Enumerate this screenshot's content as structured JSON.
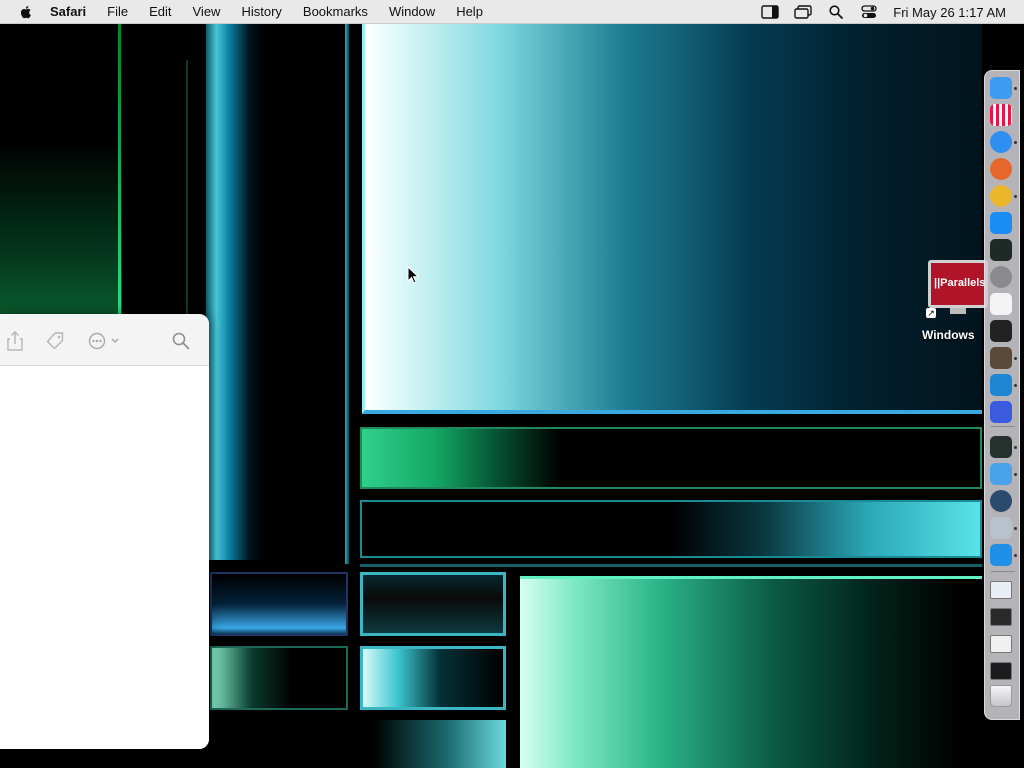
{
  "menubar": {
    "apple_icon": "apple-logo-icon",
    "app_name": "Safari",
    "menus": [
      "File",
      "Edit",
      "View",
      "History",
      "Bookmarks",
      "Window",
      "Help"
    ],
    "status_icons": [
      "sidebar-icon",
      "screen-mirroring-icon",
      "spotlight-search-icon",
      "control-center-icon"
    ],
    "clock": "Fri May 26  1:17 AM"
  },
  "safari": {
    "toolbar_icons": [
      "share-icon",
      "tag-icon",
      "more-options-icon",
      "search-icon"
    ]
  },
  "desktop": {
    "icon_label": "Windows",
    "icon_screen_text": "||Parallels",
    "icon_name": "parallels-windows-vm-icon"
  },
  "dock": {
    "apps": [
      {
        "name": "Finder",
        "icon": "finder-icon",
        "color": "#3d9bf0",
        "running": true
      },
      {
        "name": "Launchpad",
        "icon": "launchpad-icon",
        "color": "#f2f2f2",
        "running": false
      },
      {
        "name": "Safari",
        "icon": "safari-icon",
        "color": "#2f8ff0",
        "running": true
      },
      {
        "name": "Firefox",
        "icon": "firefox-icon",
        "color": "#e8672c",
        "running": false
      },
      {
        "name": "Chrome",
        "icon": "chrome-icon",
        "color": "#e9b62c",
        "running": true
      },
      {
        "name": "App Store",
        "icon": "app-store-icon",
        "color": "#1c8cf5",
        "running": false
      },
      {
        "name": "Activity Monitor",
        "icon": "activity-monitor-icon",
        "color": "#1f2a27",
        "running": false
      },
      {
        "name": "System Settings",
        "icon": "system-settings-icon",
        "color": "#8a8a8e",
        "running": false
      },
      {
        "name": "TextEdit",
        "icon": "textedit-icon",
        "color": "#f4f4f4",
        "running": false
      },
      {
        "name": "Terminal",
        "icon": "terminal-icon",
        "color": "#222222",
        "running": false
      },
      {
        "name": "Xcode Instruments",
        "icon": "instruments-icon",
        "color": "#5a4a3a",
        "running": true
      },
      {
        "name": "Visual Studio Code",
        "icon": "vscode-icon",
        "color": "#1f86d6",
        "running": true
      },
      {
        "name": "Simulator",
        "icon": "simulator-icon",
        "color": "#3a5be0",
        "running": false
      },
      {
        "name": "Activity Monitor 2",
        "icon": "monitor-graph-icon",
        "color": "#26302d",
        "running": true
      },
      {
        "name": "Parallels Desktop",
        "icon": "parallels-icon",
        "color": "#4aa3e8",
        "running": true
      },
      {
        "name": "QuickTime",
        "icon": "quicktime-icon",
        "color": "#2c4a6e",
        "running": false
      },
      {
        "name": "Script Editor",
        "icon": "script-editor-icon",
        "color": "#b8c2cc",
        "running": true
      },
      {
        "name": "Windows",
        "icon": "windows-icon",
        "color": "#1f8fe8",
        "running": true
      }
    ],
    "minimized": [
      {
        "icon": "minimized-window-icon",
        "color": "#e8eef4"
      },
      {
        "icon": "minimized-window-icon",
        "color": "#2a2a2a"
      },
      {
        "icon": "minimized-window-icon",
        "color": "#f0f0f0"
      },
      {
        "icon": "minimized-window-icon",
        "color": "#1c1c1e"
      }
    ],
    "trash_icon": "trash-icon"
  }
}
